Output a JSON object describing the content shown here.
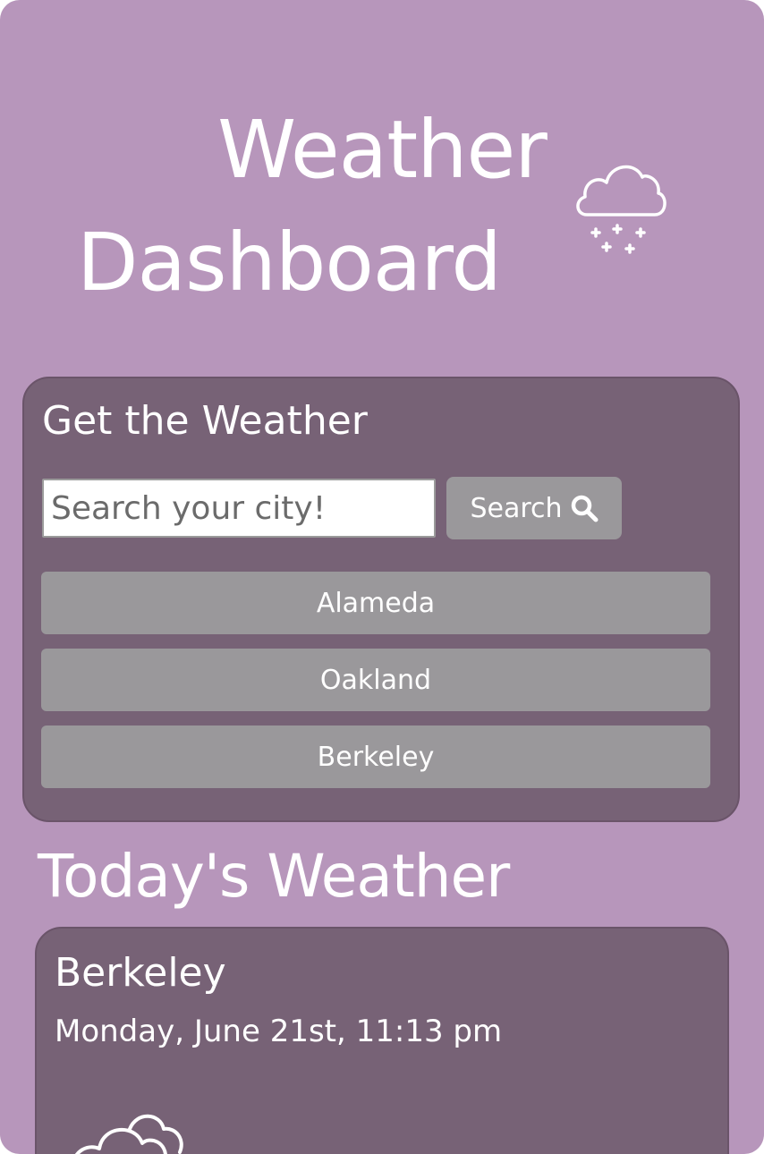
{
  "header": {
    "title_line1": "Weather",
    "title_line2": "Dashboard",
    "icon": "snow-cloud-icon"
  },
  "search": {
    "heading": "Get the Weather",
    "placeholder": "Search your city!",
    "value": "",
    "button_label": "Search",
    "button_icon": "search-icon"
  },
  "history": {
    "cities": [
      "Alameda",
      "Oakland",
      "Berkeley"
    ]
  },
  "today": {
    "heading": "Today's Weather",
    "city": "Berkeley",
    "datetime": "Monday, June 21st, 11:13 pm",
    "icon": "cloudy-icon"
  },
  "colors": {
    "background": "#b796bb",
    "card": "#776276",
    "button": "#9a989b",
    "text": "#ffffff"
  }
}
